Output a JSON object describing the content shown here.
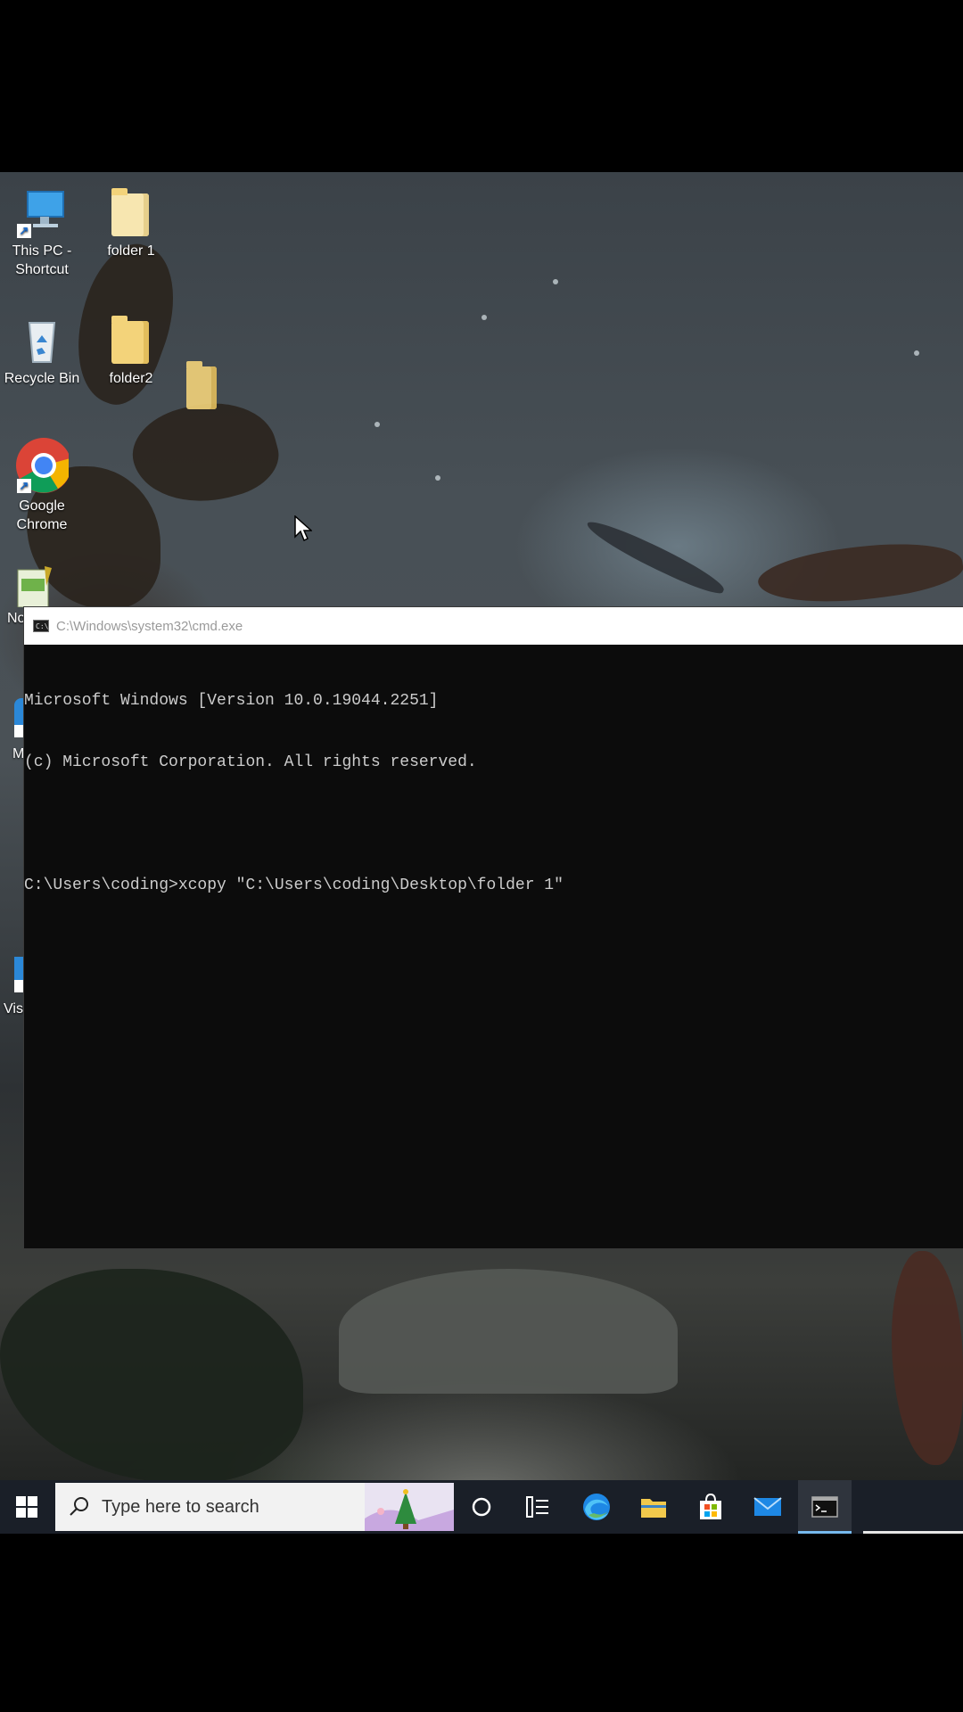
{
  "desktop": {
    "icons": [
      {
        "label": "This PC - Shortcut",
        "icon": "monitor-icon"
      },
      {
        "label": "folder 1",
        "icon": "folder-icon"
      },
      {
        "label": "Recycle Bin",
        "icon": "recycle-bin-icon"
      },
      {
        "label": "folder2",
        "icon": "folder-icon"
      },
      {
        "label": "Google Chrome",
        "icon": "chrome-icon"
      },
      {
        "label": "No",
        "icon": "notepad-icon"
      },
      {
        "label": "M",
        "icon": "app-shortcut-icon"
      },
      {
        "label": "Visu",
        "icon": "vscode-icon"
      }
    ]
  },
  "cmd_window": {
    "title": "C:\\Windows\\system32\\cmd.exe",
    "lines": [
      "Microsoft Windows [Version 10.0.19044.2251]",
      "(c) Microsoft Corporation. All rights reserved.",
      "",
      "C:\\Users\\coding>xcopy \"C:\\Users\\coding\\Desktop\\folder 1\""
    ]
  },
  "taskbar": {
    "search_placeholder": "Type here to search",
    "items": [
      "start-icon",
      "cortana-icon",
      "task-view-icon",
      "edge-icon",
      "file-explorer-icon",
      "store-icon",
      "mail-icon",
      "cmd-icon"
    ]
  }
}
